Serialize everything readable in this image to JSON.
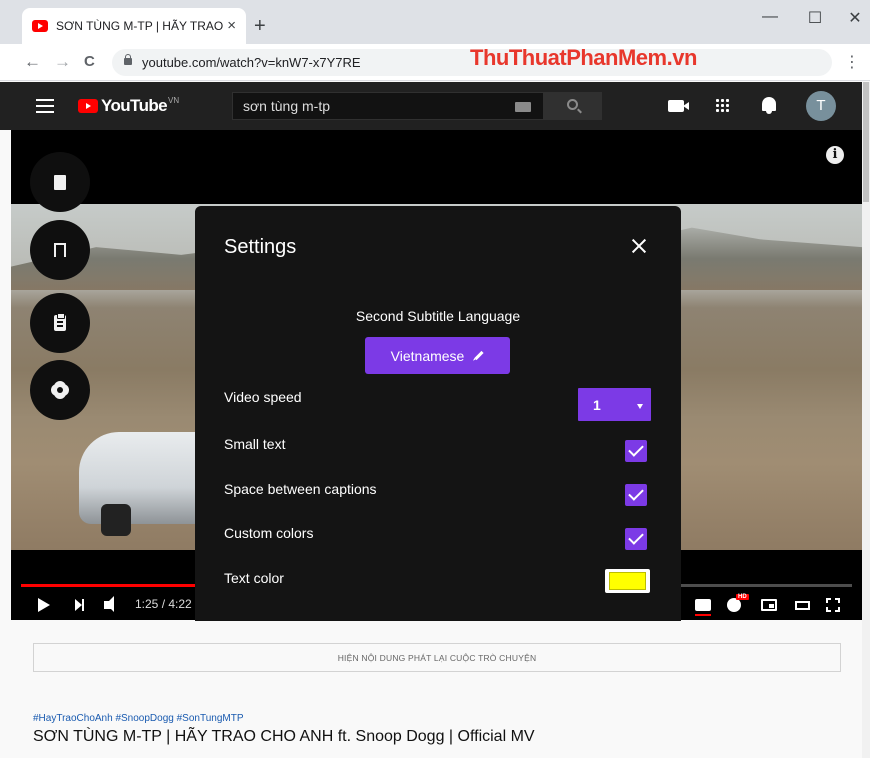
{
  "browser": {
    "tab_title": "SƠN TÙNG M-TP | HÃY TRAO CHO ANH",
    "tab_close": "×",
    "new_tab": "+",
    "minimize": "—",
    "maximize": "☐",
    "close": "✕",
    "back": "←",
    "forward": "→",
    "reload": "C",
    "url": "youtube.com/watch?v=knW7-x7Y7RE",
    "menu": "⋮",
    "watermark": "ThuThuatPhanMem.vn"
  },
  "youtube": {
    "logo_text": "YouTube",
    "region": "VN",
    "search_value": "sơn tùng m-tp",
    "avatar_letter": "T"
  },
  "player": {
    "time": "1:25 / 4:22",
    "progress_fraction": 0.324,
    "info": "i",
    "hd": "HD"
  },
  "settings": {
    "title": "Settings",
    "second_subtitle_label": "Second Subtitle Language",
    "language": "Vietnamese",
    "video_speed_label": "Video speed",
    "video_speed_value": "1",
    "small_text_label": "Small text",
    "small_text_checked": true,
    "space_label": "Space between captions",
    "space_checked": true,
    "custom_colors_label": "Custom colors",
    "custom_colors_checked": true,
    "text_color_label": "Text color",
    "text_color": "#ffff00",
    "accent_color": "#7c3ae6"
  },
  "page": {
    "chat_replay": "HIỆN NỘI DUNG PHÁT LẠI CUỘC TRÒ CHUYỆN",
    "hashtags": "#HayTraoChoAnh #SnoopDogg #SonTungMTP",
    "video_title": "SƠN TÙNG M-TP | HÃY TRAO CHO ANH ft. Snoop Dogg | Official MV"
  }
}
